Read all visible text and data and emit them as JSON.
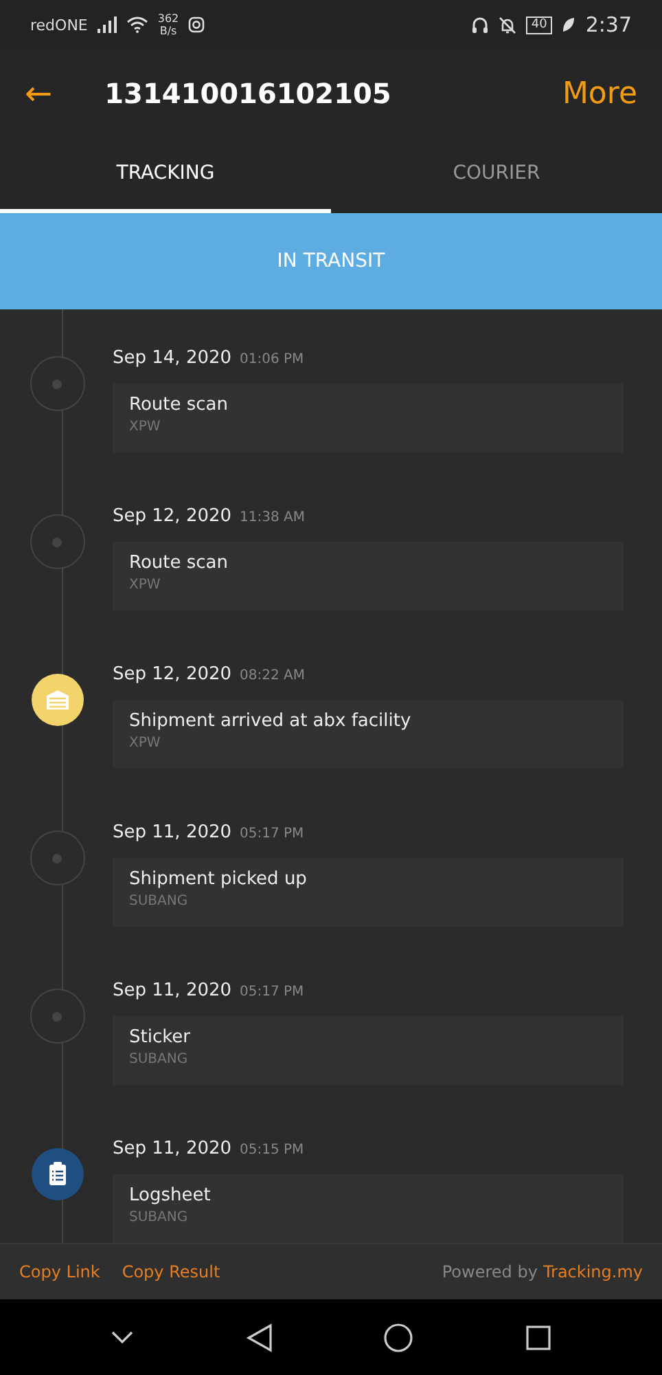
{
  "status_bar": {
    "carrier": "redONE",
    "speed_value": "362",
    "speed_unit": "B/s",
    "battery": "40",
    "time": "2:37"
  },
  "header": {
    "back": "←",
    "title": "131410016102105",
    "more": "More"
  },
  "tabs": [
    {
      "label": "TRACKING",
      "selected": true
    },
    {
      "label": "COURIER",
      "selected": false
    }
  ],
  "status_banner": "IN TRANSIT",
  "events": [
    {
      "kind": "dot",
      "date": "Sep 14, 2020",
      "time": "01:06 PM",
      "title": "Route scan",
      "location": "XPW"
    },
    {
      "kind": "dot",
      "date": "Sep 12, 2020",
      "time": "11:38 AM",
      "title": "Route scan",
      "location": "XPW"
    },
    {
      "kind": "warehouse",
      "date": "Sep 12, 2020",
      "time": "08:22 AM",
      "title": "Shipment arrived at abx facility",
      "location": "XPW"
    },
    {
      "kind": "dot",
      "date": "Sep 11, 2020",
      "time": "05:17 PM",
      "title": "Shipment picked up",
      "location": "SUBANG"
    },
    {
      "kind": "dot",
      "date": "Sep 11, 2020",
      "time": "05:17 PM",
      "title": "Sticker",
      "location": "SUBANG"
    },
    {
      "kind": "clipboard",
      "date": "Sep 11, 2020",
      "time": "05:15 PM",
      "title": "Logsheet",
      "location": "SUBANG"
    }
  ],
  "footer": {
    "links": [
      "Copy Link",
      "Copy Result"
    ],
    "powered_by": "Powered by",
    "brand": "Tracking.my"
  }
}
